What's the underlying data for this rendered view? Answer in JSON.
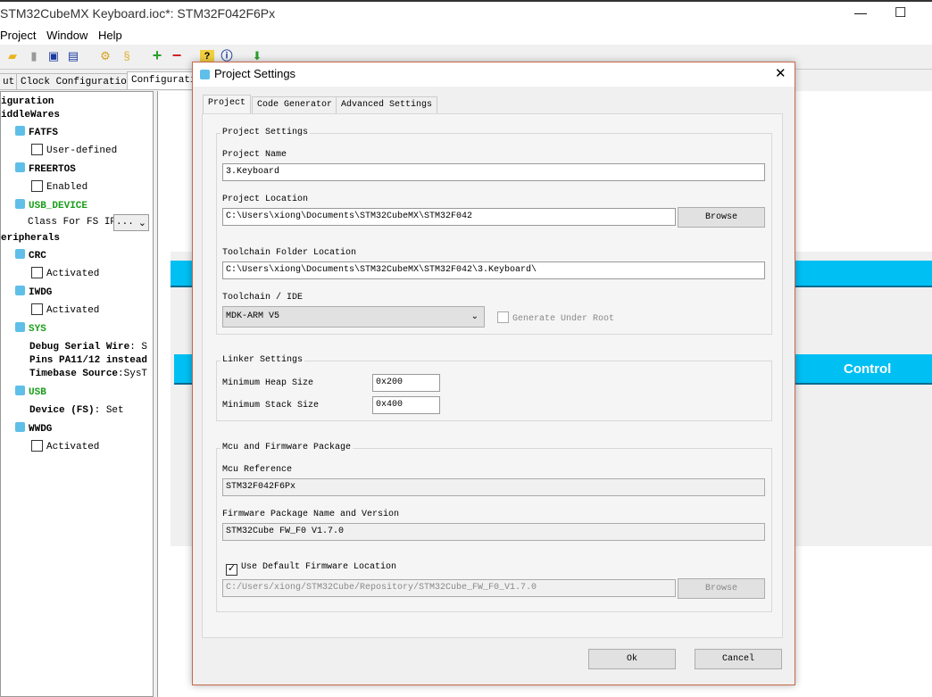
{
  "window": {
    "title": "STM32CubeMX Keyboard.ioc*: STM32F042F6Px",
    "minimize": "—",
    "maximize": "☐"
  },
  "menu": [
    "Project",
    "Window",
    "Help"
  ],
  "toolbar_icons": [
    "open-folder-icon",
    "save-all-icon",
    "save-icon",
    "save-as-icon",
    "generate-report-icon",
    "script-icon",
    "zoom-in-icon",
    "zoom-out-icon",
    "help-icon",
    "info-icon",
    "download-icon"
  ],
  "main_tabs": [
    "ut",
    "Clock Configuration",
    "Configurati"
  ],
  "tree": {
    "root": "iguration",
    "middlewares": "iddleWares",
    "fatfs": "FATFS",
    "fatfs_opt": "User-defined",
    "freertos": "FREERTOS",
    "freertos_opt": "Enabled",
    "usb_device": "USB_DEVICE",
    "class_label": "Class For FS IP",
    "class_value": "...",
    "peripherals": "eripherals",
    "crc": "CRC",
    "crc_opt": "Activated",
    "iwdg": "IWDG",
    "iwdg_opt": "Activated",
    "sys": "SYS",
    "sys_debug_k": "Debug Serial Wire",
    "sys_debug_v": ": S",
    "sys_pins": "Pins PA11/12 instead",
    "sys_tb_k": "Timebase Source",
    "sys_tb_v": ":SysT",
    "usb": "USB",
    "usb_dev_k": "Device (FS)",
    "usb_dev_v": ": Set",
    "wwdg": "WWDG",
    "wwdg_opt": "Activated"
  },
  "canvas": {
    "control_label": "Control",
    "accent": "#00bff3"
  },
  "dialog": {
    "title": "Project Settings",
    "close": "✕",
    "tabs": [
      "Project",
      "Code Generator",
      "Advanced Settings"
    ],
    "project_group": "Project Settings",
    "project_name_label": "Project Name",
    "project_name": "3.Keyboard",
    "project_location_label": "Project Location",
    "project_location": "C:\\Users\\xiong\\Documents\\STM32CubeMX\\STM32F042",
    "browse": "Browse",
    "toolchain_folder_label": "Toolchain Folder Location",
    "toolchain_folder": "C:\\Users\\xiong\\Documents\\STM32CubeMX\\STM32F042\\3.Keyboard\\",
    "toolchain_label": "Toolchain / IDE",
    "toolchain": "MDK-ARM V5",
    "generate_under_root": "Generate Under Root",
    "generate_under_root_checked": false,
    "linker_group": "Linker Settings",
    "heap_label": "Minimum Heap Size",
    "heap": "0x200",
    "stack_label": "Minimum Stack Size",
    "stack": "0x400",
    "mcu_group": "Mcu and Firmware Package",
    "mcu_ref_label": "Mcu Reference",
    "mcu_ref": "STM32F042F6Px",
    "fw_label": "Firmware Package Name and Version",
    "fw": "STM32Cube FW_F0 V1.7.0",
    "use_default_fw": "Use Default Firmware Location",
    "use_default_fw_checked": true,
    "fw_location": "C:/Users/xiong/STM32Cube/Repository/STM32Cube_FW_F0_V1.7.0",
    "fw_browse": "Browse",
    "ok": "Ok",
    "cancel": "Cancel"
  }
}
